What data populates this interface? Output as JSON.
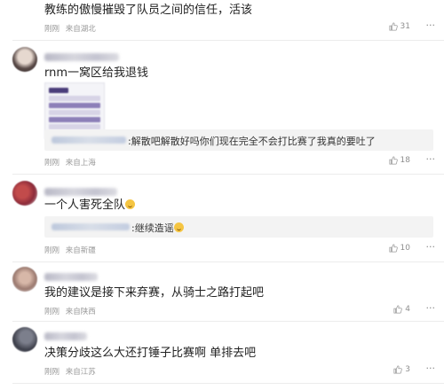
{
  "comments": [
    {
      "text": "教练的傲慢摧毁了队员之间的信任，活该",
      "time": "刚刚",
      "location": "来自湖北",
      "likes": "31"
    },
    {
      "text": "rnm一窝区给我退钱",
      "time": "刚刚",
      "location": "来自上海",
      "likes": "18",
      "reply_text": ":解散吧解散好吗你们现在完全不会打比赛了我真的要吐了"
    },
    {
      "text": "一个人害死全队",
      "time": "刚刚",
      "location": "来自新疆",
      "likes": "10",
      "reply_text": ":继续造谣"
    },
    {
      "text": "我的建议是接下来弃赛，从骑士之路打起吧",
      "time": "刚刚",
      "location": "来自陕西",
      "likes": "4"
    },
    {
      "text": "决策分歧这么大还打锤子比赛啊 单排去吧",
      "time": "刚刚",
      "location": "来自江苏",
      "likes": "3"
    }
  ],
  "icons": {
    "like": "thumbs-up-icon",
    "more": "more-dots-icon",
    "emoji": "smile-emoji-icon"
  },
  "colors": {
    "meta_text": "#9a9a9a",
    "reply_bg": "#f3f3f3"
  }
}
